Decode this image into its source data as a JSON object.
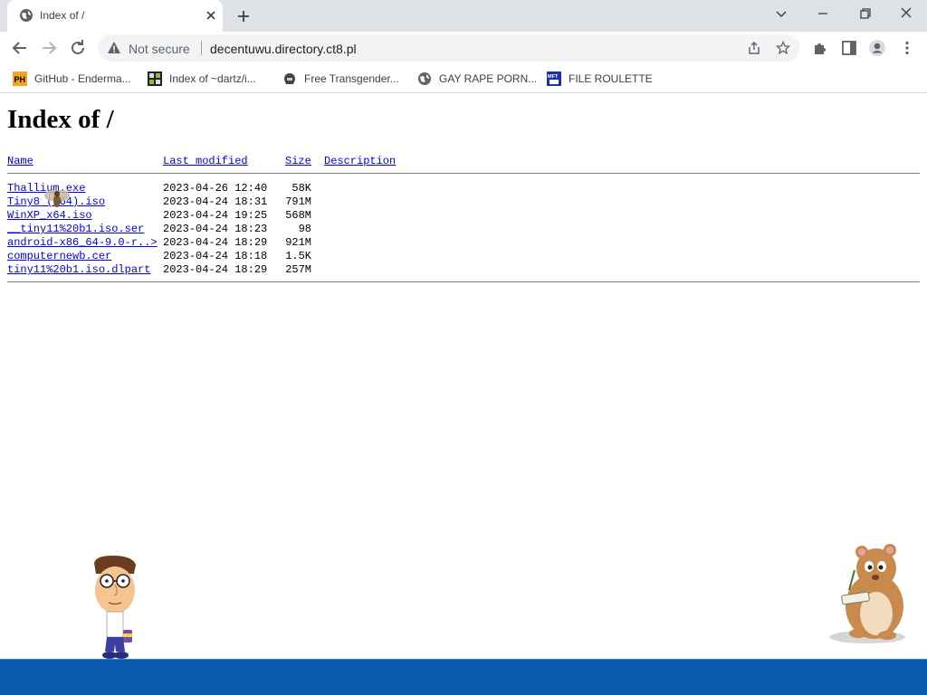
{
  "browser": {
    "tab": {
      "title": "Index of /",
      "favicon": "globe-icon",
      "close": "close-icon"
    },
    "new_tab": "plus-icon",
    "window_controls": [
      "chevron-down-icon",
      "minimize-icon",
      "restore-icon",
      "close-icon"
    ],
    "toolbar": {
      "back": "back-arrow-icon",
      "forward": "forward-arrow-icon",
      "reload": "reload-icon",
      "security_label": "Not secure",
      "url": "decentuwu.directory.ct8.pl",
      "share": "share-icon",
      "bookmark": "star-icon",
      "extensions": "puzzle-icon",
      "sidepanel": "sidepanel-icon",
      "profile": "profile-icon",
      "menu": "kebab-menu-icon"
    },
    "bookmarks": [
      {
        "label": "GitHub - Enderma...",
        "icon": "ph-icon"
      },
      {
        "label": "Index of ~dartz/i...",
        "icon": "pixel-icon"
      },
      {
        "label": "Free Transgender...",
        "icon": "helmet-icon"
      },
      {
        "label": "GAY RAPE PORN...",
        "icon": "globe-icon"
      },
      {
        "label": "FILE ROULETTE",
        "icon": "mft-icon"
      }
    ]
  },
  "page": {
    "title": "Index of /",
    "columns": {
      "name": "Name",
      "modified": "Last modified",
      "size": "Size",
      "description": "Description"
    },
    "rows": [
      {
        "name": "Thallium.exe",
        "modified": "2023-04-26 12:40",
        "size": "58K"
      },
      {
        "name": "Tiny8 (x64).iso",
        "modified": "2023-04-24 18:31",
        "size": "791M"
      },
      {
        "name": "WinXP_x64.iso",
        "modified": "2023-04-24 19:25",
        "size": "568M"
      },
      {
        "name": "__tiny11%20b1.iso.ser",
        "modified": "2023-04-24 18:23",
        "size": "98"
      },
      {
        "name": "android-x86_64-9.0-r..>",
        "modified": "2023-04-24 18:29",
        "size": "921M"
      },
      {
        "name": "computernewb.cer",
        "modified": "2023-04-24 18:18",
        "size": "1.5K"
      },
      {
        "name": "tiny11%20b1.iso.dlpart",
        "modified": "2023-04-24 18:29",
        "size": "257M"
      }
    ]
  },
  "colors": {
    "link": "#0000ee",
    "taskbar": "#0a5bb0",
    "tabstrip": "#dee1e6"
  }
}
